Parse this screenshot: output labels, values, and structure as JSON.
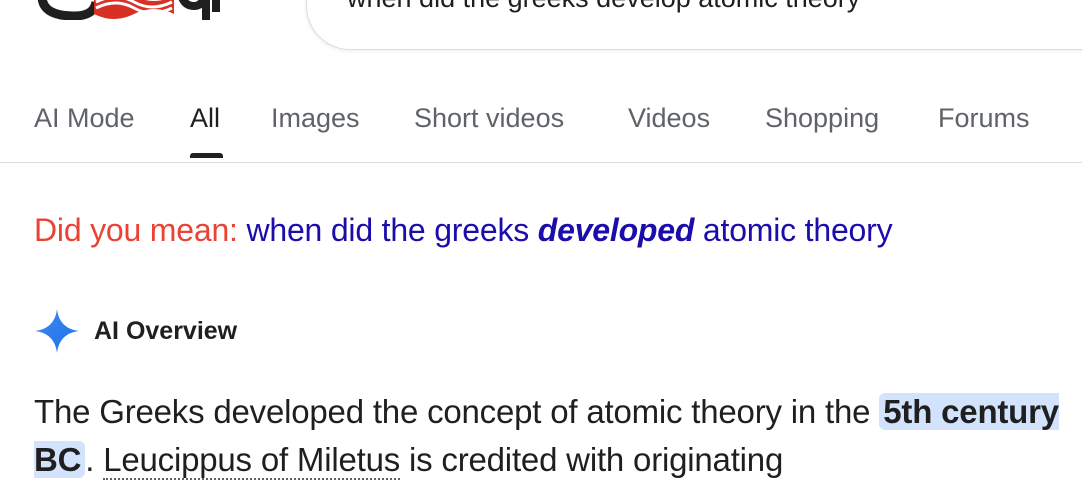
{
  "search": {
    "query": "when did the greeks develop atomic theory"
  },
  "tabs": [
    {
      "label": "AI Mode",
      "active": false
    },
    {
      "label": "All",
      "active": true
    },
    {
      "label": "Images",
      "active": false
    },
    {
      "label": "Short videos",
      "active": false
    },
    {
      "label": "Videos",
      "active": false
    },
    {
      "label": "Shopping",
      "active": false
    },
    {
      "label": "Forums",
      "active": false
    }
  ],
  "did_you_mean": {
    "prefix": "Did you mean:",
    "part1": "when did the greeks",
    "corrected_word": "developed",
    "part2": "atomic theory"
  },
  "ai_overview": {
    "title": "AI Overview",
    "text_before": "The Greeks developed the concept of atomic theory in the",
    "highlight": "5th century BC",
    "text_after_highlight": ".",
    "link": "Leucippus of Miletus",
    "text_end": "is credited with originating"
  },
  "colors": {
    "tab_inactive": "#5f6368",
    "link": "#1a0dab",
    "dym_prefix": "#ea4335",
    "highlight_bg": "#d3e3fd",
    "sparkle": "#4285f4"
  },
  "icons": {
    "logo": "google-logo",
    "sparkle": "ai-sparkle-icon"
  }
}
